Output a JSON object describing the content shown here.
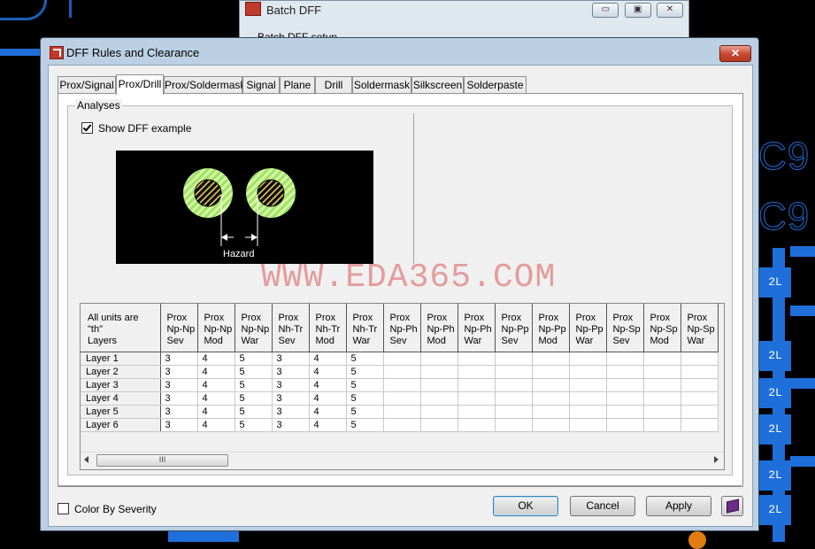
{
  "background": {
    "pcb_labels": [
      "C9",
      "C9"
    ],
    "pad_labels": [
      "2L",
      "2L",
      "2L",
      "2L",
      "2L",
      "2L"
    ]
  },
  "back_window": {
    "title": "Batch DFF",
    "group_label": "Batch DFF setup",
    "buttons": [
      "minimize",
      "maximize",
      "close"
    ]
  },
  "dialog": {
    "title": "DFF Rules and Clearance",
    "close_label": "✕",
    "tabs": [
      {
        "label": "Prox/Signal",
        "active": false
      },
      {
        "label": "Prox/Drill",
        "active": true
      },
      {
        "label": "Prox/Soldermask",
        "active": false
      },
      {
        "label": "Signal",
        "active": false
      },
      {
        "label": "Plane",
        "active": false
      },
      {
        "label": "Drill",
        "active": false
      },
      {
        "label": "Soldermask",
        "active": false
      },
      {
        "label": "Silkscreen",
        "active": false
      },
      {
        "label": "Solderpaste",
        "active": false
      }
    ],
    "analyses": {
      "group_label": "Analyses",
      "show_example_label": "Show DFF example",
      "show_example_checked": true,
      "example_hazard_label": "Hazard"
    },
    "watermark": "WWW.EDA365.COM",
    "grid": {
      "corner_label": [
        "All units are",
        "\"th\"",
        "Layers"
      ],
      "columns": [
        [
          "Prox",
          "Np-Np",
          "Sev"
        ],
        [
          "Prox",
          "Np-Np",
          "Mod"
        ],
        [
          "Prox",
          "Np-Np",
          "War"
        ],
        [
          "Prox",
          "Nh-Tr",
          "Sev"
        ],
        [
          "Prox",
          "Nh-Tr",
          "Mod"
        ],
        [
          "Prox",
          "Nh-Tr",
          "War"
        ],
        [
          "Prox",
          "Np-Ph",
          "Sev"
        ],
        [
          "Prox",
          "Np-Ph",
          "Mod"
        ],
        [
          "Prox",
          "Np-Ph",
          "War"
        ],
        [
          "Prox",
          "Np-Pp",
          "Sev"
        ],
        [
          "Prox",
          "Np-Pp",
          "Mod"
        ],
        [
          "Prox",
          "Np-Pp",
          "War"
        ],
        [
          "Prox",
          "Np-Sp",
          "Sev"
        ],
        [
          "Prox",
          "Np-Sp",
          "Mod"
        ],
        [
          "Prox",
          "Np-Sp",
          "War"
        ]
      ],
      "rows": [
        {
          "layer": "Layer 1",
          "values": [
            "3",
            "4",
            "5",
            "3",
            "4",
            "5",
            "",
            "",
            "",
            "",
            "",
            "",
            "",
            "",
            ""
          ]
        },
        {
          "layer": "Layer 2",
          "values": [
            "3",
            "4",
            "5",
            "3",
            "4",
            "5",
            "",
            "",
            "",
            "",
            "",
            "",
            "",
            "",
            ""
          ]
        },
        {
          "layer": "Layer 3",
          "values": [
            "3",
            "4",
            "5",
            "3",
            "4",
            "5",
            "",
            "",
            "",
            "",
            "",
            "",
            "",
            "",
            ""
          ]
        },
        {
          "layer": "Layer 4",
          "values": [
            "3",
            "4",
            "5",
            "3",
            "4",
            "5",
            "",
            "",
            "",
            "",
            "",
            "",
            "",
            "",
            ""
          ]
        },
        {
          "layer": "Layer 5",
          "values": [
            "3",
            "4",
            "5",
            "3",
            "4",
            "5",
            "",
            "",
            "",
            "",
            "",
            "",
            "",
            "",
            ""
          ]
        },
        {
          "layer": "Layer 6",
          "values": [
            "3",
            "4",
            "5",
            "3",
            "4",
            "5",
            "",
            "",
            "",
            "",
            "",
            "",
            "",
            "",
            ""
          ]
        }
      ],
      "scroll_thumb_label": "III"
    },
    "color_by_severity_label": "Color By Severity",
    "color_by_severity_checked": false,
    "buttons": {
      "ok": "OK",
      "cancel": "Cancel",
      "apply": "Apply"
    }
  }
}
